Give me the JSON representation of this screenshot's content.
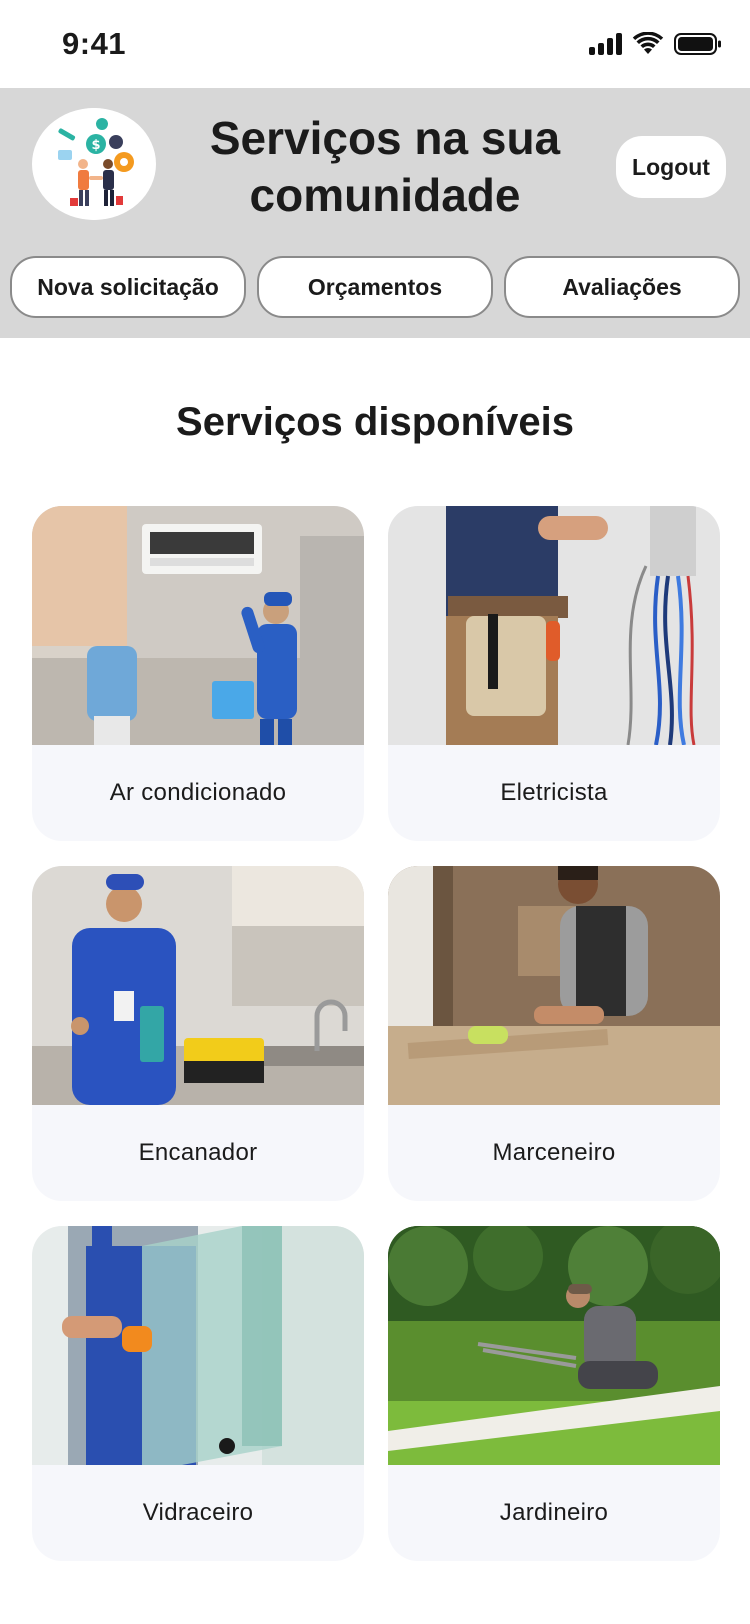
{
  "status_bar": {
    "time": "9:41",
    "icons": [
      "signal-icon",
      "wifi-icon",
      "battery-icon"
    ]
  },
  "header": {
    "logo_icon": "community-services-logo",
    "title_line1": "Serviços na sua",
    "title_line2": "comunidade",
    "logout_label": "Logout",
    "nav": [
      {
        "label": "Nova solicitação"
      },
      {
        "label": "Orçamentos"
      },
      {
        "label": "Avaliações"
      }
    ]
  },
  "main": {
    "section_title": "Serviços disponíveis",
    "services": [
      {
        "label": "Ar condicionado",
        "image": "technician-air-conditioner-photo"
      },
      {
        "label": "Eletricista",
        "image": "electrician-tool-belt-photo"
      },
      {
        "label": "Encanador",
        "image": "plumber-thumbs-up-photo"
      },
      {
        "label": "Marceneiro",
        "image": "carpenter-workshop-photo"
      },
      {
        "label": "Vidraceiro",
        "image": "glazier-glass-panel-photo"
      },
      {
        "label": "Jardineiro",
        "image": "gardener-hedge-trimming-photo"
      }
    ]
  },
  "colors": {
    "header_bg": "#d7d7d7",
    "card_bg": "#f6f7fb",
    "text": "#1b1b1b",
    "button_border": "#8a8a8a"
  }
}
